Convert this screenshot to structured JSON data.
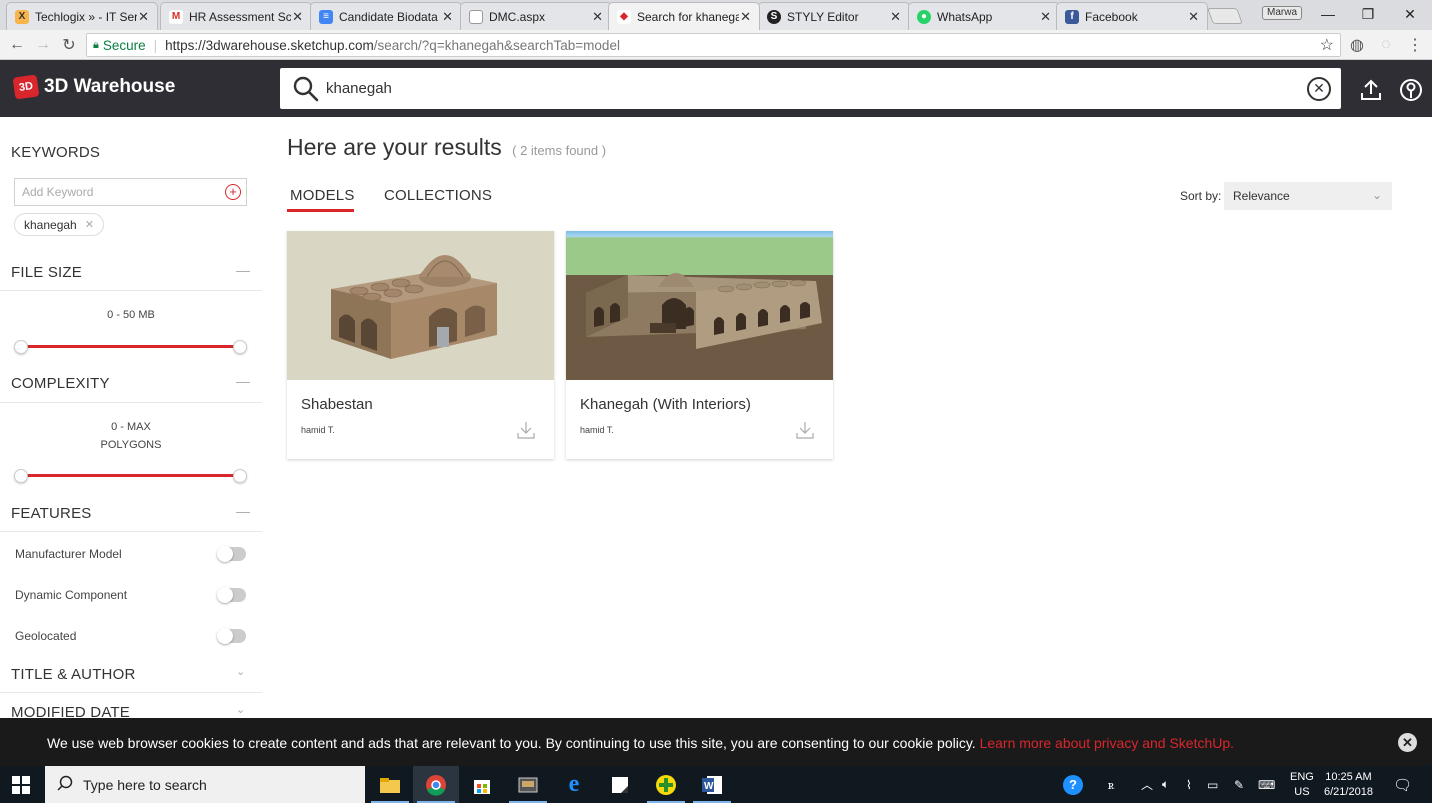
{
  "browser": {
    "tabs": [
      {
        "title": "Techlogix » - IT Ser",
        "icon_color": "#f0a030",
        "icon_char": "X"
      },
      {
        "title": "HR Assessment Sch",
        "icon_color": "#d93025",
        "icon_char": "M"
      },
      {
        "title": "Candidate Biodata",
        "icon_color": "#4285f4",
        "icon_char": "≡"
      },
      {
        "title": "DMC.aspx",
        "icon_color": "#bbbbbb",
        "icon_char": ""
      },
      {
        "title": "Search for khanega",
        "icon_color": "#d8262c",
        "icon_char": "◆"
      },
      {
        "title": "STYLY Editor",
        "icon_color": "#222222",
        "icon_char": "S"
      },
      {
        "title": "WhatsApp",
        "icon_color": "#25d366",
        "icon_char": "●"
      },
      {
        "title": "Facebook",
        "icon_color": "#3b5998",
        "icon_char": "f"
      }
    ],
    "profile_label": "Marwa",
    "secure_label": "Secure",
    "url_host": "https://3dwarehouse.sketchup.com",
    "url_rest": "/search/?q=khanegah&searchTab=model"
  },
  "app": {
    "logo_text": "3D Warehouse",
    "search_value": "khanegah"
  },
  "sidebar": {
    "keywords_title": "KEYWORDS",
    "keyword_placeholder": "Add Keyword",
    "keyword_chip": "khanegah",
    "file_size_title": "FILE SIZE",
    "file_size_range": "0 - 50 MB",
    "complexity_title": "COMPLEXITY",
    "complexity_range": "0 - MAX",
    "complexity_unit": "POLYGONS",
    "features_title": "FEATURES",
    "features": [
      {
        "label": "Manufacturer Model",
        "on": false
      },
      {
        "label": "Dynamic Component",
        "on": false
      },
      {
        "label": "Geolocated",
        "on": false
      }
    ],
    "title_author_title": "TITLE & AUTHOR",
    "modified_date_title": "MODIFIED DATE"
  },
  "results": {
    "heading": "Here are your results",
    "count": "( 2 items found )",
    "tab_models": "MODELS",
    "tab_collections": "COLLECTIONS",
    "sort_label": "Sort by:",
    "sort_value": "Relevance",
    "items": [
      {
        "title": "Shabestan",
        "author": "hamid T."
      },
      {
        "title": "Khanegah (With Interiors)",
        "author": "hamid T."
      }
    ]
  },
  "cookie": {
    "text": "We use web browser cookies to create content and ads that are relevant to you. By continuing to use this site, you are consenting to our cookie policy.",
    "link": "Learn more about privacy and SketchUp."
  },
  "taskbar": {
    "search_placeholder": "Type here to search",
    "lang_top": "ENG",
    "lang_bottom": "US",
    "time": "10:25 AM",
    "date": "6/21/2018"
  }
}
